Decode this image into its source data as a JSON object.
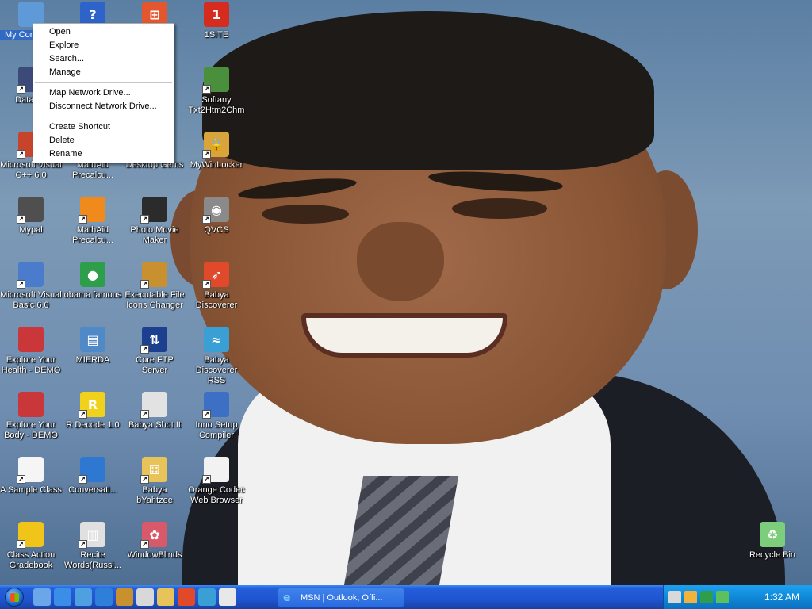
{
  "desktop_icons": [
    {
      "id": "my-computer",
      "label": "My Computer",
      "icon": "my-computer-icon",
      "color": "#5f9ad8",
      "selected": true,
      "shortcut": false
    },
    {
      "id": "help",
      "label": "",
      "icon": "help-icon",
      "color": "#2e63c9",
      "shortcut": false
    },
    {
      "id": "windows-explorer",
      "label": "",
      "icon": "windows-flag-icon",
      "color": "#e4572e",
      "shortcut": false
    },
    {
      "id": "1site",
      "label": "1SITE",
      "icon": "1site-icon",
      "color": "#d62b1f",
      "shortcut": false
    },
    {
      "id": "datawe",
      "label": "DataWe",
      "icon": "datawe-icon",
      "color": "#3c4a7a",
      "shortcut": true
    },
    {
      "id": "softany",
      "label": "Softany\nTxt2Htm2Chm",
      "icon": "softany-icon",
      "color": "#4a8f3c",
      "shortcut": true
    },
    {
      "id": "ms-visual-cpp",
      "label": "Microsoft Visual\nC++ 6.0",
      "icon": "visual-cpp-icon",
      "color": "#c7442c",
      "shortcut": true
    },
    {
      "id": "mathaid-1",
      "label": "MathAid\nPrecalcu...",
      "icon": "mathaid-icon",
      "color": "#3ea24f",
      "shortcut": true
    },
    {
      "id": "desktop-gems",
      "label": "Desktop Gems",
      "icon": "desktop-gems-icon",
      "color": "#6b8fc0",
      "shortcut": true
    },
    {
      "id": "mywinlocker",
      "label": "MyWinLocker",
      "icon": "lock-icon",
      "color": "#d9a43a",
      "shortcut": true
    },
    {
      "id": "mypal",
      "label": "Mypal",
      "icon": "raccoon-icon",
      "color": "#4f4f4f",
      "shortcut": true
    },
    {
      "id": "mathaid-2",
      "label": "MathAid\nPrecalcu...",
      "icon": "mathaid-icon",
      "color": "#f08a1c",
      "shortcut": true
    },
    {
      "id": "photo-movie-maker",
      "label": "Photo Movie\nMaker",
      "icon": "clapperboard-icon",
      "color": "#2b2b2b",
      "shortcut": true
    },
    {
      "id": "qvcs",
      "label": "QVCS",
      "icon": "camera-icon",
      "color": "#8a8a8a",
      "shortcut": true
    },
    {
      "id": "ms-visual-basic",
      "label": "Microsoft Visual\nBasic 6.0",
      "icon": "visual-basic-icon",
      "color": "#4b7ccc",
      "shortcut": true
    },
    {
      "id": "obama-famous",
      "label": "obama famous",
      "icon": "chrome-icon",
      "color": "#2f9e4b",
      "shortcut": false
    },
    {
      "id": "exe-icons-changer",
      "label": "Executable File\nIcons Changer",
      "icon": "exe-changer-icon",
      "color": "#c8902f",
      "shortcut": true
    },
    {
      "id": "babya-discoverer",
      "label": "Babya\nDiscoverer",
      "icon": "rocket-icon",
      "color": "#e04a2a",
      "shortcut": true
    },
    {
      "id": "explore-health",
      "label": "Explore Your\nHealth - DEMO",
      "icon": "health-icon",
      "color": "#c9373a",
      "shortcut": false
    },
    {
      "id": "mierda",
      "label": "MIERDA",
      "icon": "document-icon",
      "color": "#4f89c7",
      "shortcut": false
    },
    {
      "id": "core-ftp",
      "label": "Core FTP\nServer",
      "icon": "ftp-icon",
      "color": "#1d3f8f",
      "shortcut": true
    },
    {
      "id": "babya-rss",
      "label": "Babya\nDiscoverer RSS",
      "icon": "rss-icon",
      "color": "#3a9fd4",
      "shortcut": false
    },
    {
      "id": "explore-body",
      "label": "Explore Your\nBody - DEMO",
      "icon": "body-icon",
      "color": "#c9373a",
      "shortcut": false
    },
    {
      "id": "r-decode",
      "label": "R Decode 1.0",
      "icon": "r-decode-icon",
      "color": "#f0d21c",
      "shortcut": true
    },
    {
      "id": "babya-shot-it",
      "label": "Babya Shot It",
      "icon": "screenshot-icon",
      "color": "#e2e2e2",
      "shortcut": true
    },
    {
      "id": "inno-setup",
      "label": "Inno Setup\nCompiler",
      "icon": "installer-icon",
      "color": "#3d6fc4",
      "shortcut": true
    },
    {
      "id": "sample-class",
      "label": "A Sample Class",
      "icon": "class-icon",
      "color": "#f5f5f5",
      "shortcut": true
    },
    {
      "id": "conversation",
      "label": "Conversati...",
      "icon": "conversation-icon",
      "color": "#2f78d1",
      "shortcut": true
    },
    {
      "id": "babya-yahtzee",
      "label": "Babya\nbYahtzee",
      "icon": "dice-icon",
      "color": "#e7c35a",
      "shortcut": true
    },
    {
      "id": "orange-codec",
      "label": "Orange Codec\nWeb Browser",
      "icon": "browser-icon",
      "color": "#f2f2f2",
      "shortcut": true
    },
    {
      "id": "class-action",
      "label": "Class Action\nGradebook",
      "icon": "gradebook-icon",
      "color": "#f0c419",
      "shortcut": true
    },
    {
      "id": "recite-words",
      "label": "Recite\nWords(Russi...",
      "icon": "book-icon",
      "color": "#e0e0e0",
      "shortcut": true
    },
    {
      "id": "windowblinds",
      "label": "WindowBlinds",
      "icon": "palette-icon",
      "color": "#d85a6a",
      "shortcut": true
    },
    {
      "id": "recycle-bin",
      "label": "Recycle Bin",
      "icon": "recycle-bin-icon",
      "color": "#7ccd7c",
      "shortcut": false
    }
  ],
  "context_menu": {
    "groups": [
      [
        "Open",
        "Explore",
        "Search...",
        "Manage"
      ],
      [
        "Map Network Drive...",
        "Disconnect Network Drive..."
      ],
      [
        "Create Shortcut",
        "Delete",
        "Rename"
      ]
    ]
  },
  "taskbar": {
    "quick_launch": [
      {
        "icon": "computer-icon",
        "color": "#6aa6e8"
      },
      {
        "icon": "internet-explorer-icon",
        "color": "#3b8ee8"
      },
      {
        "icon": "windows-update-icon",
        "color": "#4fa0e0"
      },
      {
        "icon": "media-player-icon",
        "color": "#2e7fd8"
      },
      {
        "icon": "exe-changer-icon",
        "color": "#c8902f"
      },
      {
        "icon": "screenshot-icon",
        "color": "#d8d8d8"
      },
      {
        "icon": "dice-icon",
        "color": "#e7c35a"
      },
      {
        "icon": "rocket-icon",
        "color": "#e04a2a"
      },
      {
        "icon": "rss-icon",
        "color": "#3a9fd4"
      },
      {
        "icon": "document-icon",
        "color": "#e8e8e8"
      }
    ],
    "active_task": "MSN | Outlook, Offi...",
    "tray_icons": [
      {
        "icon": "keyboard-icon",
        "color": "#d9d9d9"
      },
      {
        "icon": "tray-app-icon",
        "color": "#f2b33d"
      },
      {
        "icon": "tray-pause-icon",
        "color": "#2f9e4b"
      },
      {
        "icon": "network-icon",
        "color": "#5cc15c"
      }
    ],
    "clock": "1:32 AM"
  }
}
